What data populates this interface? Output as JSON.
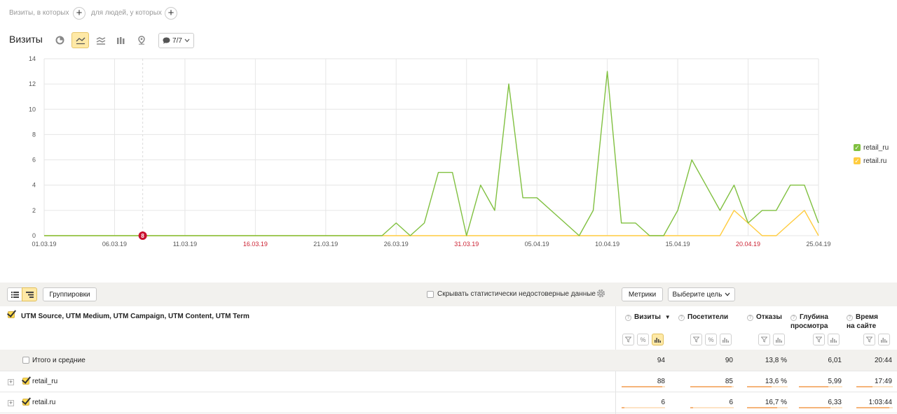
{
  "segments": {
    "visits_label": "Визиты, в которых",
    "people_label": "для людей, у которых",
    "add_symbol": "+"
  },
  "chart_header": {
    "title": "Визиты",
    "chart_types": [
      "pie-chart-icon",
      "line-chart-icon",
      "area-chart-icon",
      "bar-chart-icon",
      "map-pin-icon"
    ],
    "active_chart_type": "line-chart-icon",
    "notes_label": "7/7"
  },
  "colors": {
    "green": "#80c040",
    "yellow": "#ffcc3f",
    "weekend_red": "#cc2233",
    "accent": "#ffdb4d"
  },
  "chart_data": {
    "type": "line",
    "x": [
      "01.03.19",
      "02.03.19",
      "03.03.19",
      "04.03.19",
      "05.03.19",
      "06.03.19",
      "07.03.19",
      "08.03.19",
      "09.03.19",
      "10.03.19",
      "11.03.19",
      "12.03.19",
      "13.03.19",
      "14.03.19",
      "15.03.19",
      "16.03.19",
      "17.03.19",
      "18.03.19",
      "19.03.19",
      "20.03.19",
      "21.03.19",
      "22.03.19",
      "23.03.19",
      "24.03.19",
      "25.03.19",
      "26.03.19",
      "27.03.19",
      "28.03.19",
      "29.03.19",
      "30.03.19",
      "31.03.19",
      "01.04.19",
      "02.04.19",
      "03.04.19",
      "04.04.19",
      "05.04.19",
      "06.04.19",
      "07.04.19",
      "08.04.19",
      "09.04.19",
      "10.04.19",
      "11.04.19",
      "12.04.19",
      "13.04.19",
      "14.04.19",
      "15.04.19",
      "16.04.19",
      "17.04.19",
      "18.04.19",
      "19.04.19",
      "20.04.19",
      "21.04.19",
      "22.04.19",
      "23.04.19",
      "24.04.19",
      "25.04.19"
    ],
    "x_tick_labels": [
      {
        "label": "01.03.19",
        "weekend": false
      },
      {
        "label": "06.03.19",
        "weekend": false
      },
      {
        "label": "11.03.19",
        "weekend": false
      },
      {
        "label": "16.03.19",
        "weekend": true
      },
      {
        "label": "21.03.19",
        "weekend": false
      },
      {
        "label": "26.03.19",
        "weekend": false
      },
      {
        "label": "31.03.19",
        "weekend": true
      },
      {
        "label": "05.04.19",
        "weekend": false
      },
      {
        "label": "10.04.19",
        "weekend": false
      },
      {
        "label": "15.04.19",
        "weekend": false
      },
      {
        "label": "20.04.19",
        "weekend": true
      },
      {
        "label": "25.04.19",
        "weekend": false
      }
    ],
    "y_ticks": [
      0,
      2,
      4,
      6,
      8,
      10,
      12,
      14
    ],
    "ylim": [
      0,
      14
    ],
    "grid": true,
    "legend_position": "right",
    "series": [
      {
        "name": "retail_ru",
        "color": "#80c040",
        "values": [
          0,
          0,
          0,
          0,
          0,
          0,
          0,
          0,
          0,
          0,
          0,
          0,
          0,
          0,
          0,
          0,
          0,
          0,
          0,
          0,
          0,
          0,
          0,
          0,
          0,
          1,
          0,
          1,
          5,
          5,
          0,
          4,
          2,
          12,
          3,
          3,
          2,
          1,
          0,
          2,
          13,
          1,
          1,
          0,
          0,
          2,
          6,
          4,
          2,
          4,
          1,
          2,
          2,
          4,
          4,
          1
        ]
      },
      {
        "name": "retail.ru",
        "color": "#ffcc3f",
        "values": [
          0,
          0,
          0,
          0,
          0,
          0,
          0,
          0,
          0,
          0,
          0,
          0,
          0,
          0,
          0,
          0,
          0,
          0,
          0,
          0,
          0,
          0,
          0,
          0,
          0,
          0,
          0,
          0,
          0,
          0,
          0,
          0,
          0,
          0,
          0,
          0,
          0,
          0,
          0,
          0,
          0,
          0,
          0,
          0,
          0,
          0,
          0,
          0,
          0,
          2,
          1,
          0,
          0,
          1,
          2,
          0
        ]
      }
    ],
    "annotation": {
      "date": "08.03.19",
      "symbol": "8"
    }
  },
  "toolbar": {
    "groupings_label": "Группировки",
    "hide_unreliable_label": "Скрывать статистически недостоверные данные",
    "metrics_label": "Метрики",
    "goal_label": "Выберите цель"
  },
  "table": {
    "dimension_title": "UTM Source, UTM Medium, UTM Campaign, UTM Content, UTM Term",
    "columns": [
      {
        "line1": "Визиты",
        "line2": "",
        "sort": "▼"
      },
      {
        "line1": "Посетители",
        "line2": "",
        "sort": ""
      },
      {
        "line1": "Отказы",
        "line2": "",
        "sort": ""
      },
      {
        "line1": "Глубина",
        "line2": "просмотра",
        "sort": ""
      },
      {
        "line1": "Время",
        "line2": "на сайте",
        "sort": ""
      }
    ],
    "total": {
      "label": "Итого и средние",
      "values": [
        "94",
        "90",
        "13,8 %",
        "6,01",
        "20:44"
      ]
    },
    "rows": [
      {
        "label": "retail_ru",
        "values": [
          "88",
          "85",
          "13,6 %",
          "5,99",
          "17:49"
        ],
        "bars": [
          0.936,
          0.944,
          0.6,
          0.68,
          0.45
        ]
      },
      {
        "label": "retail.ru",
        "values": [
          "6",
          "6",
          "16,7 %",
          "6,33",
          "1:03:44"
        ],
        "bars": [
          0.064,
          0.067,
          0.74,
          0.72,
          0.9
        ]
      }
    ]
  }
}
